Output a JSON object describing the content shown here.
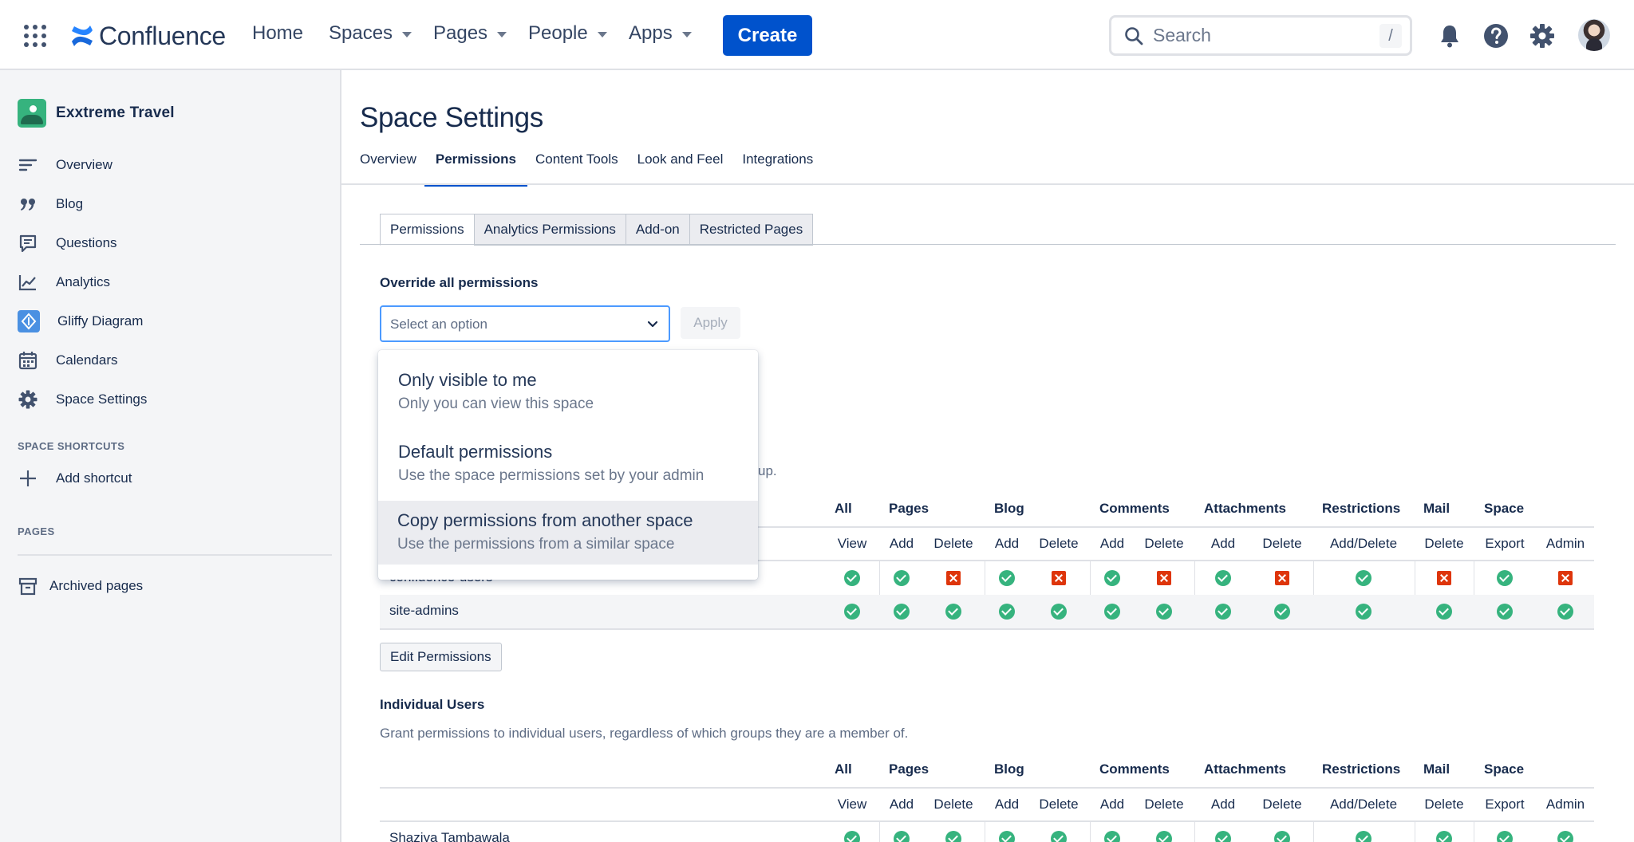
{
  "topnav": {
    "logo_text": "Confluence",
    "home": "Home",
    "spaces": "Spaces",
    "pages": "Pages",
    "people": "People",
    "apps": "Apps",
    "create": "Create",
    "search_placeholder": "Search",
    "search_shortcut": "/",
    "accent": "#0052cc"
  },
  "sidebar": {
    "space_name": "Exxtreme Travel",
    "items": [
      {
        "label": "Overview",
        "icon": "lines-icon"
      },
      {
        "label": "Blog",
        "icon": "quote-icon"
      },
      {
        "label": "Questions",
        "icon": "speech-bubble-icon"
      },
      {
        "label": "Analytics",
        "icon": "line-chart-icon"
      },
      {
        "label": "Gliffy Diagram",
        "icon": "gliffy-icon"
      },
      {
        "label": "Calendars",
        "icon": "calendar-icon"
      },
      {
        "label": "Space Settings",
        "icon": "gear-icon"
      }
    ],
    "shortcuts_heading": "SPACE SHORTCUTS",
    "add_shortcut": "Add shortcut",
    "pages_heading": "PAGES",
    "archived_pages": "Archived pages"
  },
  "main": {
    "title": "Space Settings",
    "tabs": [
      "Overview",
      "Permissions",
      "Content Tools",
      "Look and Feel",
      "Integrations"
    ],
    "active_tab": "Permissions",
    "subtabs": [
      "Permissions",
      "Analytics Permissions",
      "Add-on",
      "Restricted Pages"
    ],
    "override_label": "Override all permissions",
    "select_placeholder": "Select an option",
    "apply": "Apply",
    "dropdown": [
      {
        "title": "Only visible to me",
        "desc": "Only you can view this space"
      },
      {
        "title": "Default permissions",
        "desc": "Use the space permissions set by your admin"
      },
      {
        "title": "Copy permissions from another space",
        "desc": "Use the permissions from a similar space"
      }
    ],
    "groups_helper_tail": "up.",
    "edit_permissions": "Edit Permissions",
    "individual_title": "Individual Users",
    "individual_desc": "Grant permissions to individual users, regardless of which groups they are a member of."
  },
  "permissions_header": {
    "groups": [
      "All",
      "Pages",
      "Blog",
      "Comments",
      "Attachments",
      "Restrictions",
      "Mail",
      "Space"
    ],
    "columns": [
      "View",
      "Add",
      "Delete",
      "Add",
      "Delete",
      "Add",
      "Delete",
      "Add",
      "Delete",
      "Add/Delete",
      "Delete",
      "Export",
      "Admin"
    ]
  },
  "group_rows": [
    {
      "name": "confluence-users",
      "perms": [
        true,
        true,
        false,
        true,
        false,
        true,
        false,
        true,
        false,
        true,
        false,
        true,
        false
      ]
    },
    {
      "name": "site-admins",
      "perms": [
        true,
        true,
        true,
        true,
        true,
        true,
        true,
        true,
        true,
        true,
        true,
        true,
        true
      ]
    }
  ],
  "user_rows": [
    {
      "name": "Shaziya Tambawala",
      "perms": [
        true,
        true,
        true,
        true,
        true,
        true,
        true,
        true,
        true,
        true,
        true,
        true,
        true
      ]
    }
  ]
}
